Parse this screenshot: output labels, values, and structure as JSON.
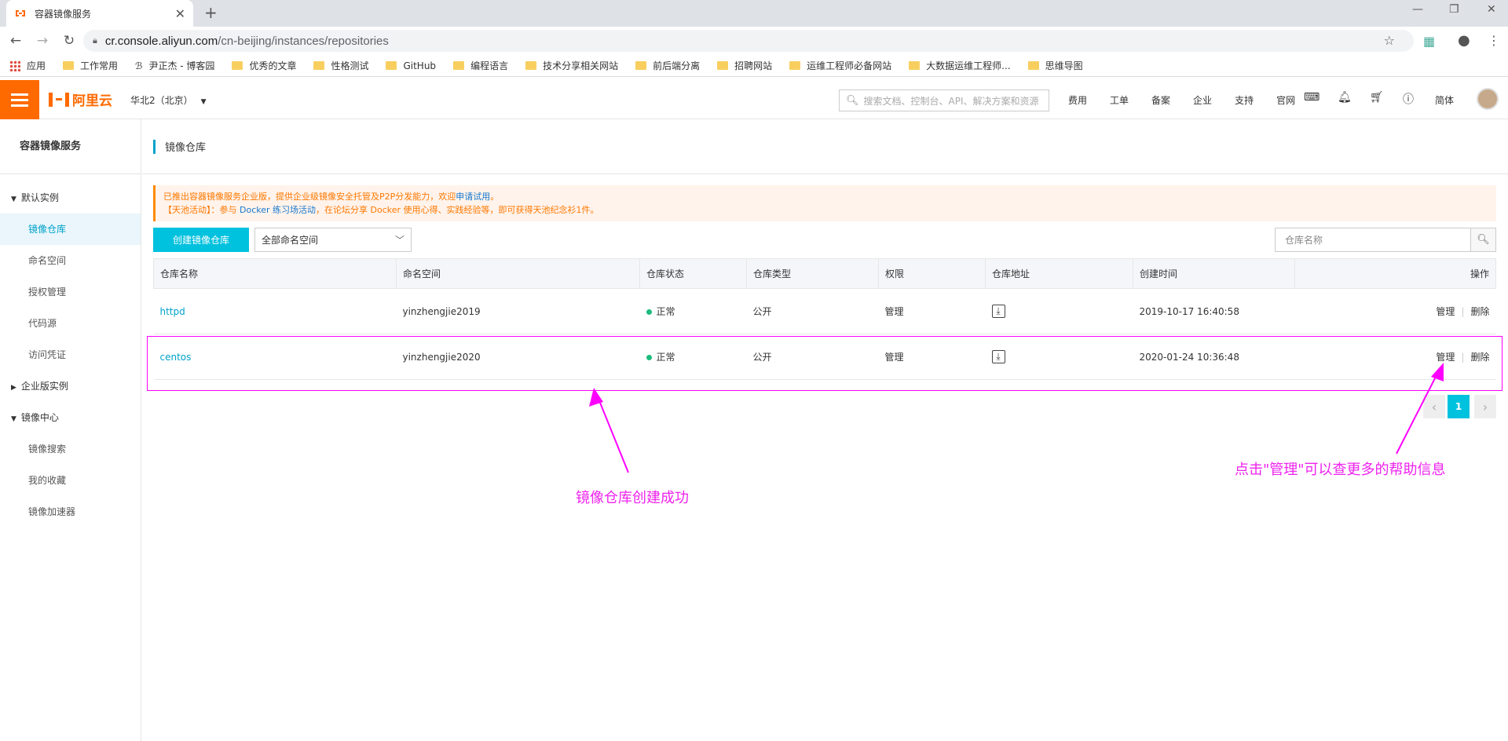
{
  "browser": {
    "tab_title": "容器镜像服务",
    "url_host": "cr.console.aliyun.com",
    "url_path": "/cn-beijing/instances/repositories",
    "bookmarks": [
      "应用",
      "工作常用",
      "尹正杰 - 博客园",
      "优秀的文章",
      "性格测试",
      "GitHub",
      "编程语言",
      "技术分享相关网站",
      "前后端分离",
      "招聘网站",
      "运维工程师必备网站",
      "大数据运维工程师...",
      "思维导图"
    ]
  },
  "header": {
    "logo_text": "阿里云",
    "region": "华北2（北京）",
    "search_placeholder": "搜索文档、控制台、API、解决方案和资源",
    "links": [
      "费用",
      "工单",
      "备案",
      "企业",
      "支持",
      "官网"
    ],
    "lang": "简体",
    "accent_color": "#ff6a00"
  },
  "sidebar": {
    "title": "容器镜像服务",
    "group_default": "默认实例",
    "items_default": [
      "镜像仓库",
      "命名空间",
      "授权管理",
      "代码源",
      "访问凭证"
    ],
    "group_enterprise": "企业版实例",
    "group_center": "镜像中心",
    "items_center": [
      "镜像搜索",
      "我的收藏",
      "镜像加速器"
    ]
  },
  "main": {
    "title": "镜像仓库",
    "notice_line1_a": "已推出容器镜像服务企业版，提供企业级镜像安全托管及P2P分发能力，欢迎",
    "notice_line1_link": "申请试用",
    "notice_line1_b": "。",
    "notice_line2_a": "【天池活动】：参与 ",
    "notice_line2_link": "Docker 练习场活动",
    "notice_line2_b": "，在论坛分享 Docker 使用心得、实践经验等，即可获得天池纪念衫1件。",
    "create_button": "创建镜像仓库",
    "namespace_select": "全部命名空间",
    "repo_search_placeholder": "仓库名称",
    "columns": [
      "仓库名称",
      "命名空间",
      "仓库状态",
      "仓库类型",
      "权限",
      "仓库地址",
      "创建时间",
      "操作"
    ],
    "rows": [
      {
        "name": "httpd",
        "namespace": "yinzhengjie2019",
        "status": "正常",
        "type": "公开",
        "perm": "管理",
        "created": "2019-10-17 16:40:58",
        "op_manage": "管理",
        "op_delete": "删除"
      },
      {
        "name": "centos",
        "namespace": "yinzhengjie2020",
        "status": "正常",
        "type": "公开",
        "perm": "管理",
        "created": "2020-01-24 10:36:48",
        "op_manage": "管理",
        "op_delete": "删除"
      }
    ],
    "page": "1"
  },
  "annotations": {
    "left": "镜像仓库创建成功",
    "right": "点击\"管理\"可以查更多的帮助信息",
    "color": "#ee22ee"
  }
}
